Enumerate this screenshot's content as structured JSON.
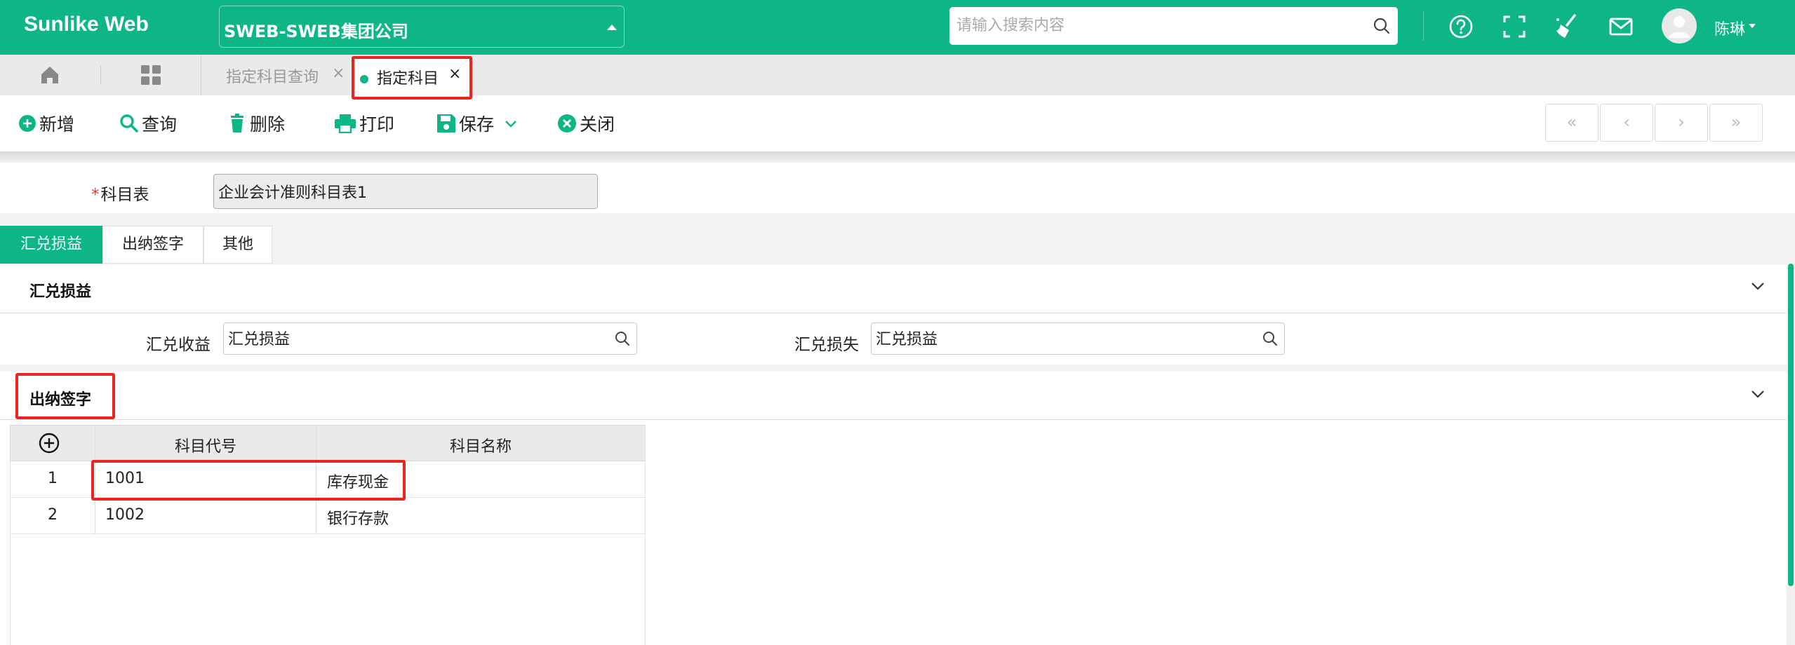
{
  "header": {
    "brand": "Sunlike Web",
    "company": "SWEB-SWEB集团公司",
    "search_placeholder": "请输入搜索内容",
    "user_name": "陈琳"
  },
  "tabs": [
    {
      "label": "指定科目查询"
    },
    {
      "label": "指定科目",
      "active": true
    }
  ],
  "toolbar": {
    "add": "新增",
    "query": "查询",
    "delete": "删除",
    "print": "打印",
    "save": "保存",
    "close": "关闭",
    "pager": [
      "«",
      "‹",
      "›",
      "»"
    ]
  },
  "account_table": {
    "label": "科目表",
    "value": "企业会计准则科目表1"
  },
  "section_tabs": [
    "汇兑损益",
    "出纳签字",
    "其他"
  ],
  "exchange_panel": {
    "title": "汇兑损益",
    "income_label": "汇兑收益",
    "income_value": "汇兑损益",
    "loss_label": "汇兑损失",
    "loss_value": "汇兑损益"
  },
  "cashier_panel": {
    "title": "出纳签字",
    "columns": [
      "科目代号",
      "科目名称"
    ],
    "rows": [
      {
        "no": "1",
        "code": "1001",
        "name": "库存现金"
      },
      {
        "no": "2",
        "code": "1002",
        "name": "银行存款"
      }
    ]
  },
  "colors": {
    "primary": "#0db587",
    "highlight": "#e8251f"
  }
}
